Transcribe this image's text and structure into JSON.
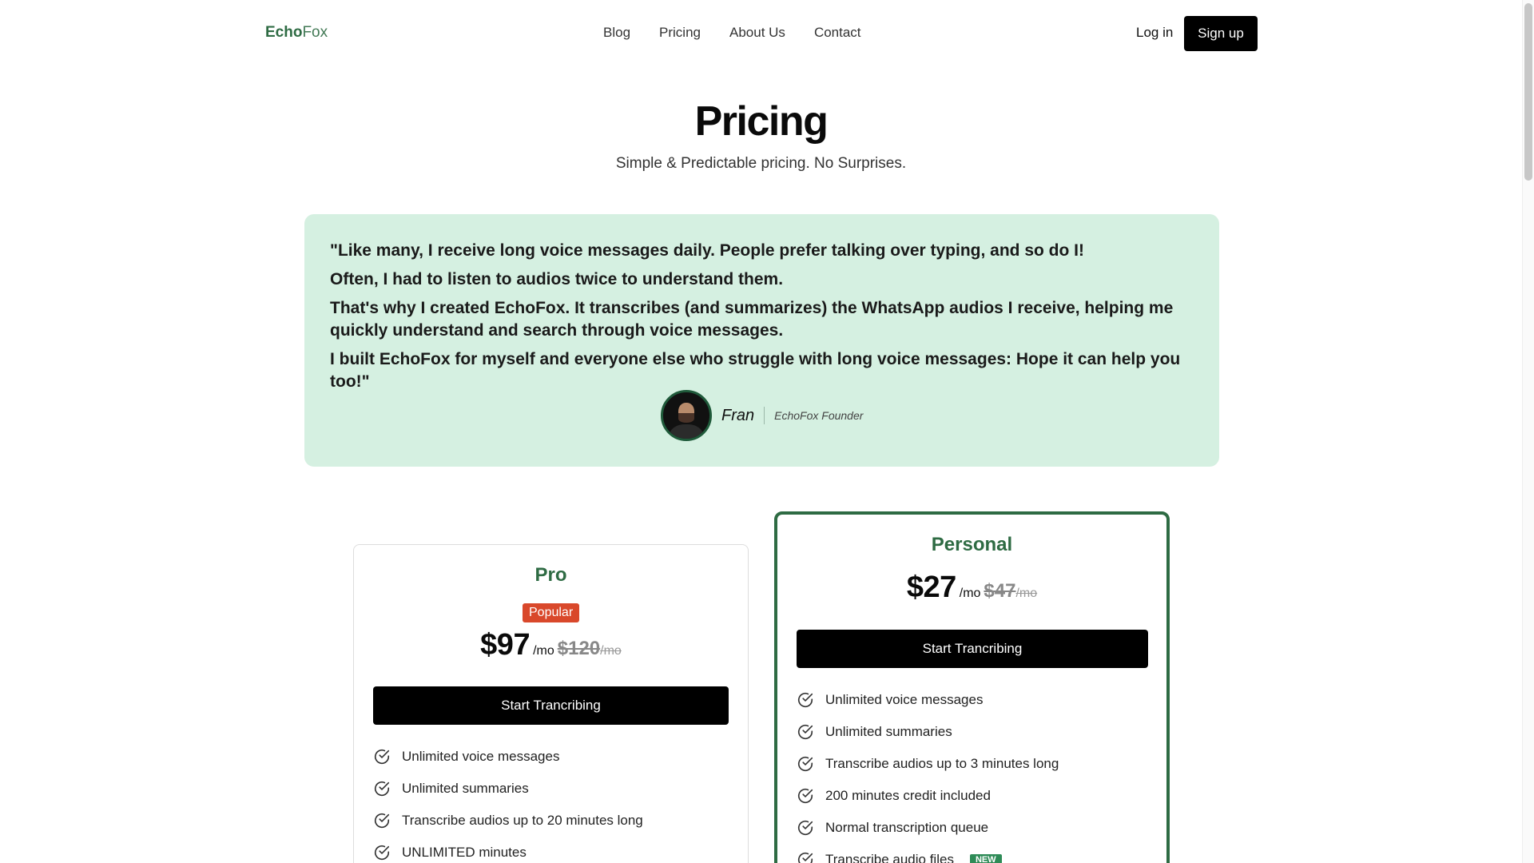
{
  "header": {
    "logo_echo": "Echo",
    "logo_fox": "Fox",
    "nav": [
      "Blog",
      "Pricing",
      "About Us",
      "Contact"
    ],
    "login": "Log in",
    "signup": "Sign up"
  },
  "hero": {
    "title": "Pricing",
    "subtitle": "Simple & Predictable pricing. No Surprises."
  },
  "testimonial": {
    "lines": [
      "\"Like many, I receive long voice messages daily. People prefer talking over typing, and so do I!",
      "Often, I had to listen to audios twice to understand them.",
      "That's why I created EchoFox. It transcribes (and summarizes) the WhatsApp audios I receive, helping me quickly understand and search through voice messages.",
      "I built EchoFox for myself and everyone else who struggle with long voice messages: Hope it can help you too!\""
    ],
    "author_name": "Fran",
    "author_role": "EchoFox Founder"
  },
  "plans": {
    "pro": {
      "name": "Pro",
      "badge": "Popular",
      "price": "$97",
      "per": "/mo",
      "old_price": "$120",
      "old_per": "/mo",
      "cta": "Start Trancribing",
      "features": [
        "Unlimited voice messages",
        "Unlimited summaries",
        "Transcribe audios up to 20 minutes long",
        "UNLIMITED minutes"
      ]
    },
    "personal": {
      "name": "Personal",
      "price": "$27",
      "per": "/mo",
      "old_price": "$47",
      "old_per": "/mo",
      "cta": "Start Trancribing",
      "features": [
        "Unlimited voice messages",
        "Unlimited summaries",
        "Transcribe audios up to 3 minutes long",
        "200 minutes credit included",
        "Normal transcription queue",
        "Transcribe audio files"
      ],
      "new_badge": "NEW"
    }
  },
  "colors": {
    "brand_green": "#2e6b43",
    "testimonial_bg": "#d5f0e1",
    "popular_badge": "#d9482b"
  },
  "icons": [
    "check-circle-icon"
  ]
}
